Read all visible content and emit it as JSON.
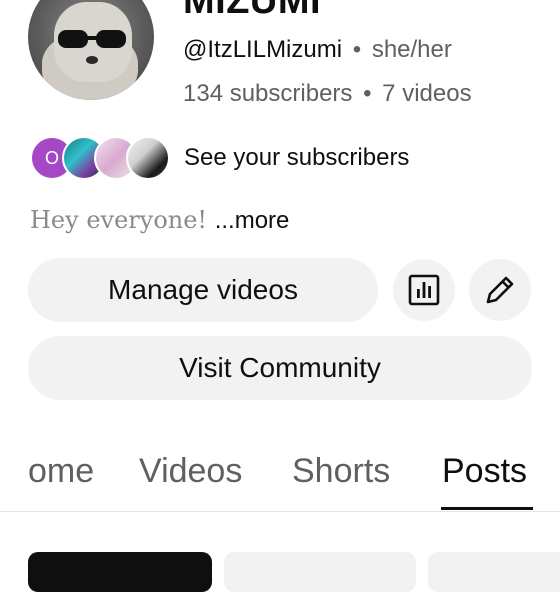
{
  "channel": {
    "name": "MIZUMI",
    "handle": "@ItzLILMizumi",
    "separator": "•",
    "pronouns": "she/her",
    "subscribers": "134 subscribers",
    "videos": "7 videos"
  },
  "subscribers_preview": {
    "first_initial": "O",
    "label": "See your subscribers"
  },
  "description": {
    "text": "Hey everyone! ",
    "more": "...more"
  },
  "actions": {
    "manage_videos": "Manage videos",
    "visit_community": "Visit Community",
    "analytics_icon": "analytics-icon",
    "edit_icon": "pencil-icon"
  },
  "tabs": [
    {
      "label": "ome",
      "selected": false
    },
    {
      "label": "Videos",
      "selected": false
    },
    {
      "label": "Shorts",
      "selected": false
    },
    {
      "label": "Posts",
      "selected": true
    }
  ],
  "colors": {
    "accent_text": "#0f0f0f",
    "secondary_text": "#606060",
    "button_bg": "#f2f2f2",
    "subscriber_avatar_purple": "#a547c6"
  }
}
